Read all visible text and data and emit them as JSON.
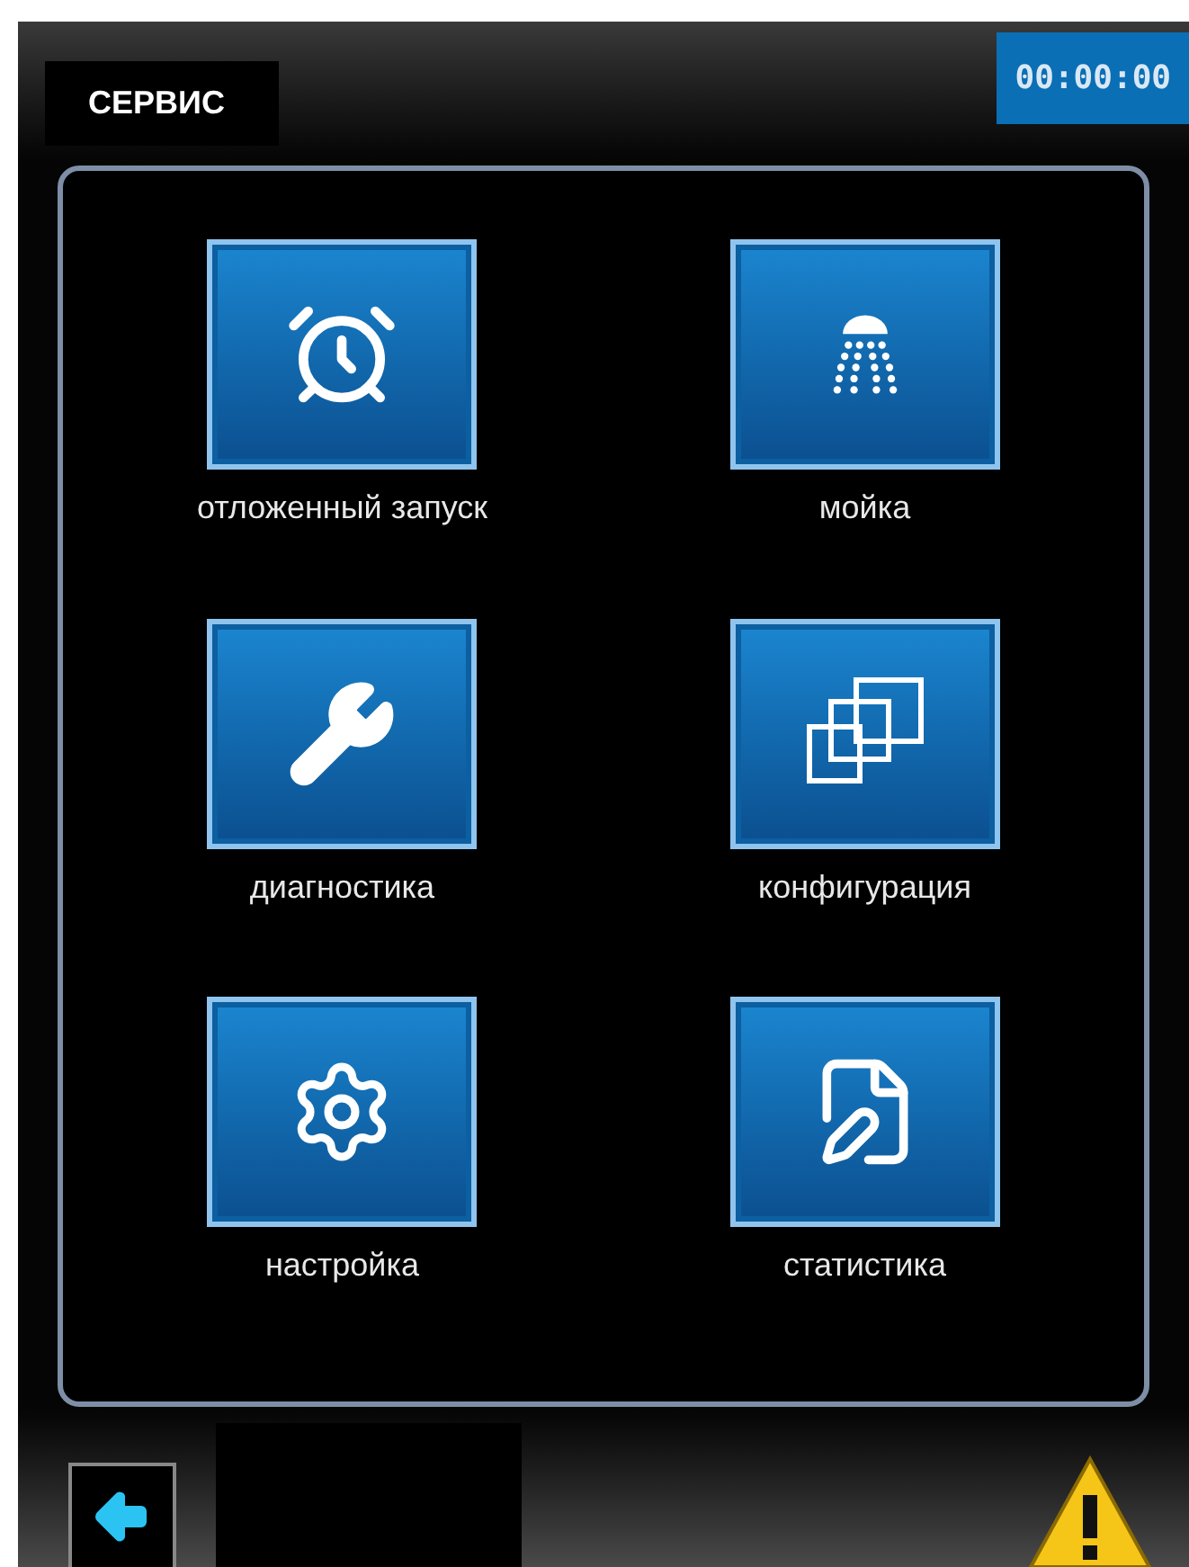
{
  "header": {
    "title": "СЕРВИС",
    "timer": "00:00:00"
  },
  "tiles": [
    {
      "kind": "alarm",
      "label": "отложенный запуск"
    },
    {
      "kind": "shower",
      "label": "мойка"
    },
    {
      "kind": "wrench",
      "label": "диагностика"
    },
    {
      "kind": "windows",
      "label": "конфигурация"
    },
    {
      "kind": "gear",
      "label": "настройка"
    },
    {
      "kind": "document",
      "label": "статистика"
    }
  ]
}
